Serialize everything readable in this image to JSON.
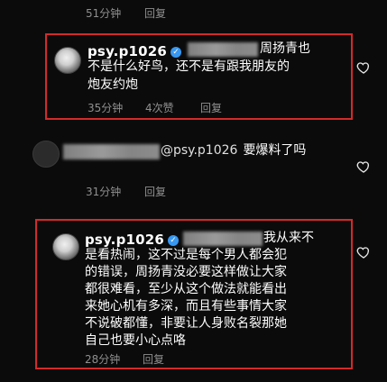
{
  "top_meta": {
    "time": "51分钟",
    "reply": "回复"
  },
  "comments": [
    {
      "handle": "psy.p1026",
      "verified_icon": "verified-badge-icon",
      "line1_tail": "周扬青也",
      "line2": "不是什么好鸟，还不是有跟我朋友的",
      "line3": "炮友约炮",
      "time": "35分钟",
      "likes": "4次赞",
      "reply": "回复"
    },
    {
      "mention": "@psy.p1026",
      "text": "要爆料了吗",
      "time": "31分钟",
      "reply": "回复"
    },
    {
      "handle": "psy.p1026",
      "verified_icon": "verified-badge-icon",
      "line1_tail": "我从来不",
      "lines": [
        "是看热闹，这不过是每个男人都会犯",
        "的错误，周扬青没必要这样做让大家",
        "都很难看，至少从这个做法就能看出",
        "来她心机有多深，而且有些事情大家",
        "不说破都懂，非要让人身败名裂那她",
        "自己也要小心点咯"
      ],
      "time": "28分钟",
      "reply": "回复"
    }
  ],
  "colors": {
    "highlight_box": "#d42a2a",
    "background": "#0b0b0b",
    "verified": "#3897f0"
  }
}
